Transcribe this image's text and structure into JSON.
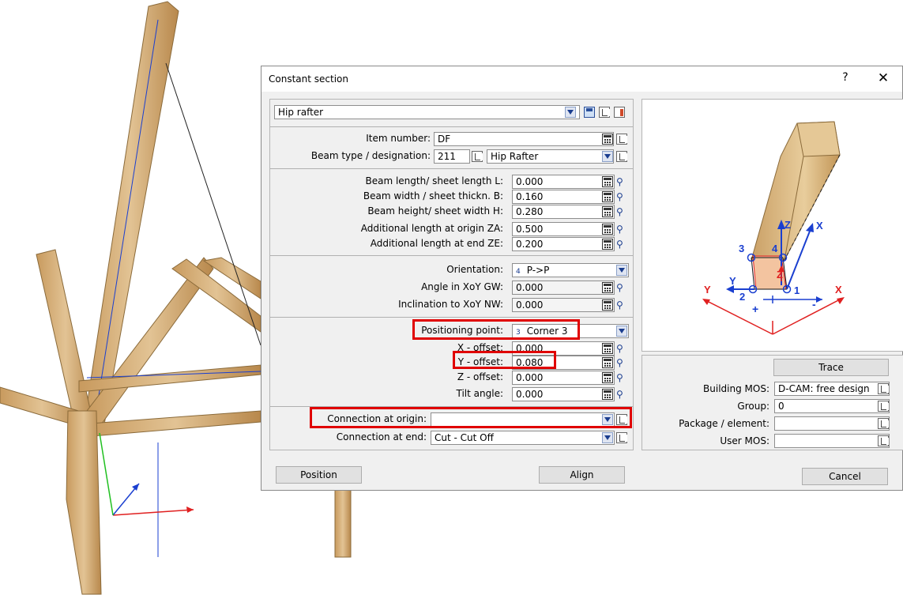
{
  "dialog": {
    "title": "Constant section",
    "help_glyph": "?",
    "close_glyph": "✕"
  },
  "preset": {
    "value": "Hip rafter"
  },
  "item": {
    "number_label": "Item number:",
    "number_value": "DF",
    "type_label": "Beam type / designation:",
    "type_code": "211",
    "type_name": "Hip Rafter"
  },
  "dimensions": [
    {
      "label": "Beam length/ sheet length L:",
      "value": "0.000"
    },
    {
      "label": "Beam width / sheet thickn. B:",
      "value": "0.160"
    },
    {
      "label": "Beam height/ sheet width H:",
      "value": "0.280"
    },
    {
      "label": "Additional length at origin ZA:",
      "value": "0.500"
    },
    {
      "label": "Additional length at end ZE:",
      "value": "0.200"
    }
  ],
  "orientation": {
    "label": "Orientation:",
    "key": "4",
    "value": "P->P",
    "angle_label": "Angle in XoY GW:",
    "angle_value": "0.000",
    "incl_label": "Inclination to XoY NW:",
    "incl_value": "0.000"
  },
  "positioning": {
    "label": "Positioning point:",
    "key": "3",
    "value": "Corner 3",
    "x_label": "X - offset:",
    "x_value": "0.000",
    "y_label": "Y - offset:",
    "y_value": "0.080",
    "z_label": "Z - offset:",
    "z_value": "0.000",
    "tilt_label": "Tilt angle:",
    "tilt_value": "0.000"
  },
  "connections": {
    "origin_label": "Connection at origin:",
    "origin_value": "",
    "end_label": "Connection at end:",
    "end_value": "Cut - Cut Off"
  },
  "right_panel": {
    "trace_label": "Trace",
    "building_mos_label": "Building MOS:",
    "building_mos_value": "D-CAM: free design",
    "group_label": "Group:",
    "group_value": "0",
    "package_label": "Package / element:",
    "package_value": "",
    "user_mos_label": "User MOS:",
    "user_mos_value": ""
  },
  "diagram_labels": {
    "p1": "1",
    "p2": "2",
    "p3": "3",
    "p4": "4",
    "x_axis": "X",
    "y_axis": "Y",
    "z_axis": "Z",
    "global_x": "X",
    "global_y": "Y",
    "z_local": "Z",
    "plus": "+",
    "minus": "-"
  },
  "buttons": {
    "position": "Position",
    "align": "Align",
    "cancel": "Cancel"
  },
  "colors": {
    "highlight": "#e00000",
    "wood": "#d9b98a",
    "axis_blue": "#1a3fd0",
    "axis_red": "#e02020",
    "axis_green": "#20c020"
  }
}
